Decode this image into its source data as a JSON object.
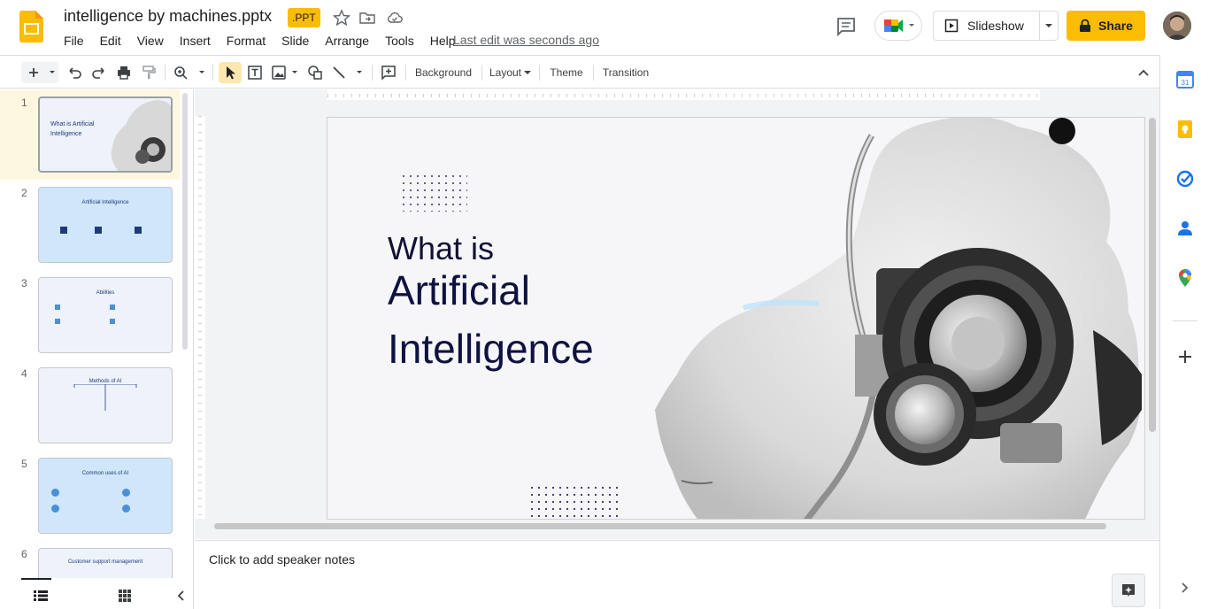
{
  "header": {
    "doc_title": "intelligence by machines.pptx",
    "file_badge": ".PPT",
    "last_edit": "Last edit was seconds ago",
    "slideshow_label": "Slideshow",
    "share_label": "Share"
  },
  "menu": {
    "items": [
      "File",
      "Edit",
      "View",
      "Insert",
      "Format",
      "Slide",
      "Arrange",
      "Tools",
      "Help"
    ]
  },
  "toolbar": {
    "background_label": "Background",
    "layout_label": "Layout",
    "theme_label": "Theme",
    "transition_label": "Transition"
  },
  "filmstrip": {
    "slides": [
      {
        "num": "1",
        "title": "What is Artificial Intelligence"
      },
      {
        "num": "2",
        "title": "Artificial Intelligence"
      },
      {
        "num": "3",
        "title": "Abilities"
      },
      {
        "num": "4",
        "title": "Methods of AI"
      },
      {
        "num": "5",
        "title": "Common uses of AI"
      },
      {
        "num": "6",
        "title": "Customer support management"
      }
    ]
  },
  "slide": {
    "line1": "What is",
    "line2": "Artificial",
    "line3": "Intelligence"
  },
  "notes": {
    "placeholder": "Click to add speaker notes"
  },
  "colors": {
    "accent": "#fbbc04",
    "slide_text": "#0f1140"
  }
}
